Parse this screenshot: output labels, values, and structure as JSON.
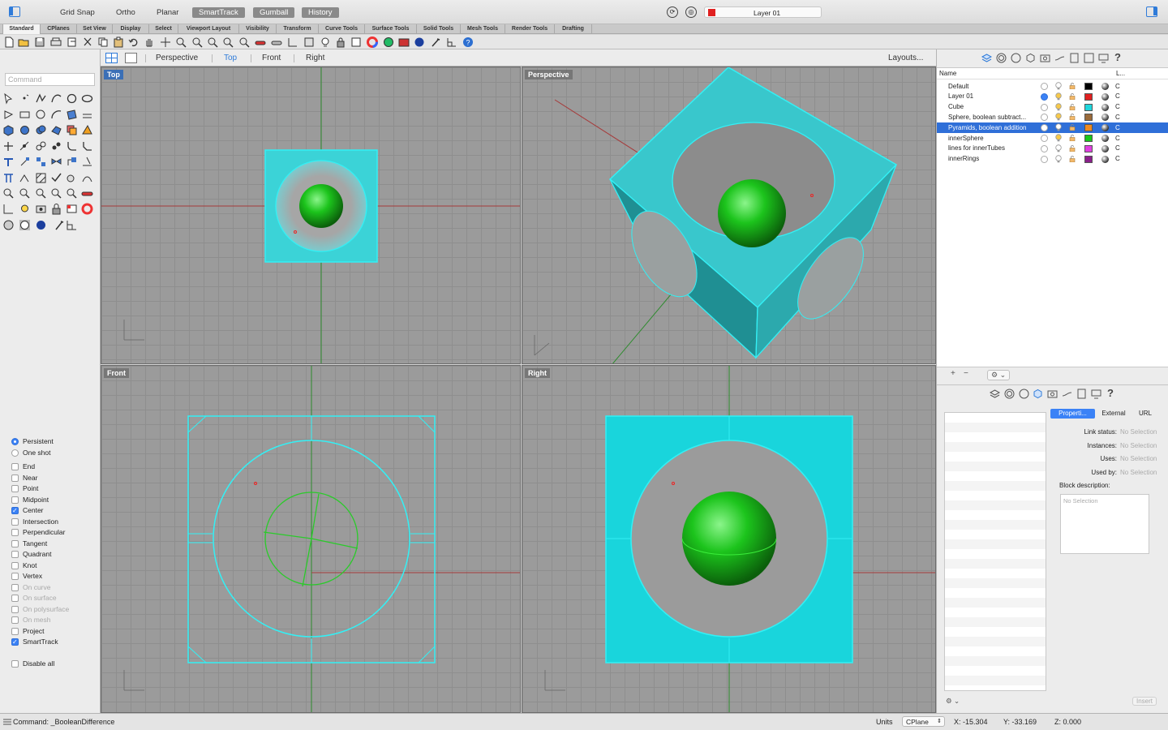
{
  "topbar": {
    "modes": [
      {
        "label": "Grid Snap",
        "on": false
      },
      {
        "label": "Ortho",
        "on": false
      },
      {
        "label": "Planar",
        "on": false
      },
      {
        "label": "SmartTrack",
        "on": true
      },
      {
        "label": "Gumball",
        "on": true
      },
      {
        "label": "History",
        "on": true
      }
    ],
    "current_layer": "Layer 01",
    "current_layer_color": "#e02020"
  },
  "tabs": [
    "Standard",
    "CPlanes",
    "Set View",
    "Display",
    "Select",
    "Viewport Layout",
    "Visibility",
    "Transform",
    "Curve Tools",
    "Surface Tools",
    "Solid Tools",
    "Mesh Tools",
    "Render Tools",
    "Drafting"
  ],
  "active_tab": "Standard",
  "command_placeholder": "Command",
  "viewport_tabs": [
    "Perspective",
    "Top",
    "Front",
    "Right"
  ],
  "active_viewport_tab": "Top",
  "layouts_label": "Layouts...",
  "viewports": {
    "top": "Top",
    "perspective": "Perspective",
    "front": "Front",
    "right": "Right"
  },
  "osnap": {
    "mode": [
      {
        "label": "Persistent",
        "on": true
      },
      {
        "label": "One shot",
        "on": false
      }
    ],
    "items": [
      {
        "label": "End",
        "on": false,
        "enabled": true
      },
      {
        "label": "Near",
        "on": false,
        "enabled": true
      },
      {
        "label": "Point",
        "on": false,
        "enabled": true
      },
      {
        "label": "Midpoint",
        "on": false,
        "enabled": true
      },
      {
        "label": "Center",
        "on": true,
        "enabled": true
      },
      {
        "label": "Intersection",
        "on": false,
        "enabled": true
      },
      {
        "label": "Perpendicular",
        "on": false,
        "enabled": true
      },
      {
        "label": "Tangent",
        "on": false,
        "enabled": true
      },
      {
        "label": "Quadrant",
        "on": false,
        "enabled": true
      },
      {
        "label": "Knot",
        "on": false,
        "enabled": true
      },
      {
        "label": "Vertex",
        "on": false,
        "enabled": true
      },
      {
        "label": "On curve",
        "on": false,
        "enabled": false
      },
      {
        "label": "On surface",
        "on": false,
        "enabled": false
      },
      {
        "label": "On polysurface",
        "on": false,
        "enabled": false
      },
      {
        "label": "On mesh",
        "on": false,
        "enabled": false
      },
      {
        "label": "Project",
        "on": false,
        "enabled": true
      },
      {
        "label": "SmartTrack",
        "on": true,
        "enabled": true
      }
    ],
    "disable_all": "Disable all"
  },
  "layers": {
    "header_name": "Name",
    "header_linetype": "L...",
    "rows": [
      {
        "name": "Default",
        "current": false,
        "color": "#000000",
        "bulb": "off",
        "selected": false
      },
      {
        "name": "Layer 01",
        "current": true,
        "color": "#e02020",
        "bulb": "on",
        "selected": false
      },
      {
        "name": "Cube",
        "current": false,
        "color": "#1fd6dc",
        "bulb": "on",
        "selected": false
      },
      {
        "name": "Sphere, boolean subtract...",
        "current": false,
        "color": "#9a6a3a",
        "bulb": "on",
        "selected": false
      },
      {
        "name": "Pyramids, boolean addition",
        "current": false,
        "color": "#f08a20",
        "bulb": "off",
        "selected": true
      },
      {
        "name": "innerSphere",
        "current": false,
        "color": "#19c619",
        "bulb": "on",
        "selected": false
      },
      {
        "name": "lines for innerTubes",
        "current": false,
        "color": "#e040e0",
        "bulb": "off",
        "selected": false
      },
      {
        "name": "innerRings",
        "current": false,
        "color": "#8a1f8a",
        "bulb": "off",
        "selected": false
      }
    ],
    "linetype_label": "C"
  },
  "layer_panel_buttons": {
    "add": "+",
    "remove": "−",
    "gear": "⚙ ⌄"
  },
  "block_panel": {
    "segments": [
      "Properti...",
      "External",
      "URL"
    ],
    "props": [
      {
        "key": "Link status:",
        "value": "No Selection"
      },
      {
        "key": "Instances:",
        "value": "No Selection"
      },
      {
        "key": "Uses:",
        "value": "No Selection"
      },
      {
        "key": "Used by:",
        "value": "No Selection"
      }
    ],
    "desc_label": "Block description:",
    "desc_placeholder": "No Selection",
    "insert": "Insert",
    "gear": "⚙ ⌄"
  },
  "status": {
    "command": "Command: _BooleanDifference",
    "units": "Units",
    "cplane": "CPlane",
    "x": "X: -15.304",
    "y": "Y: -33.169",
    "z": "Z: 0.000"
  },
  "colors": {
    "accent": "#2f7bd9",
    "cyan_object": "#1fd6dc",
    "green_sphere": "#19c619"
  }
}
